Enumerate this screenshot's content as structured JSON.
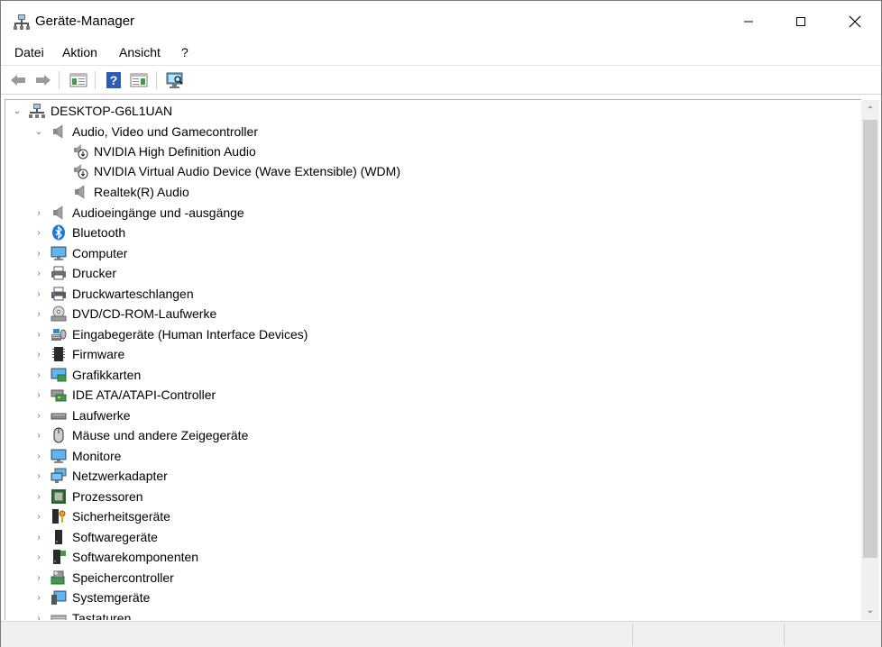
{
  "window": {
    "title": "Geräte-Manager",
    "icon": "device-manager-icon"
  },
  "menu": [
    "Datei",
    "Aktion",
    "Ansicht",
    "?"
  ],
  "toolbar": {
    "buttons": [
      "back-icon",
      "forward-icon",
      "properties-icon",
      "help-icon",
      "console-view-icon",
      "scan-hardware-icon"
    ]
  },
  "tree": {
    "root": "DESKTOP-G6L1UAN",
    "expanded_category": "Audio, Video und Gamecontroller",
    "children": [
      {
        "label": "NVIDIA High Definition Audio",
        "icon": "speaker-disabled-icon"
      },
      {
        "label": "NVIDIA Virtual Audio Device (Wave Extensible) (WDM)",
        "icon": "speaker-disabled-icon"
      },
      {
        "label": "Realtek(R) Audio",
        "icon": "speaker-icon"
      }
    ],
    "categories": [
      {
        "label": "Audioeingänge und -ausgänge",
        "icon": "speaker-icon"
      },
      {
        "label": "Bluetooth",
        "icon": "bluetooth-icon"
      },
      {
        "label": "Computer",
        "icon": "computer-icon"
      },
      {
        "label": "Drucker",
        "icon": "printer-icon"
      },
      {
        "label": "Druckwarteschlangen",
        "icon": "print-queue-icon"
      },
      {
        "label": "DVD/CD-ROM-Laufwerke",
        "icon": "dvd-drive-icon"
      },
      {
        "label": "Eingabegeräte (Human Interface Devices)",
        "icon": "hid-icon"
      },
      {
        "label": "Firmware",
        "icon": "firmware-icon"
      },
      {
        "label": "Grafikkarten",
        "icon": "display-adapter-icon"
      },
      {
        "label": "IDE ATA/ATAPI-Controller",
        "icon": "ide-controller-icon"
      },
      {
        "label": "Laufwerke",
        "icon": "disk-drive-icon"
      },
      {
        "label": "Mäuse und andere Zeigegeräte",
        "icon": "mouse-icon"
      },
      {
        "label": "Monitore",
        "icon": "monitor-icon"
      },
      {
        "label": "Netzwerkadapter",
        "icon": "network-adapter-icon"
      },
      {
        "label": "Prozessoren",
        "icon": "processor-icon"
      },
      {
        "label": "Sicherheitsgeräte",
        "icon": "security-device-icon"
      },
      {
        "label": "Softwaregeräte",
        "icon": "software-device-icon"
      },
      {
        "label": "Softwarekomponenten",
        "icon": "software-component-icon"
      },
      {
        "label": "Speichercontroller",
        "icon": "storage-controller-icon"
      },
      {
        "label": "Systemgeräte",
        "icon": "system-device-icon"
      },
      {
        "label": "Tastaturen",
        "icon": "keyboard-icon"
      }
    ]
  },
  "colors": {
    "accent_blue": "#1e78d7",
    "selection": "#cce8ff"
  }
}
